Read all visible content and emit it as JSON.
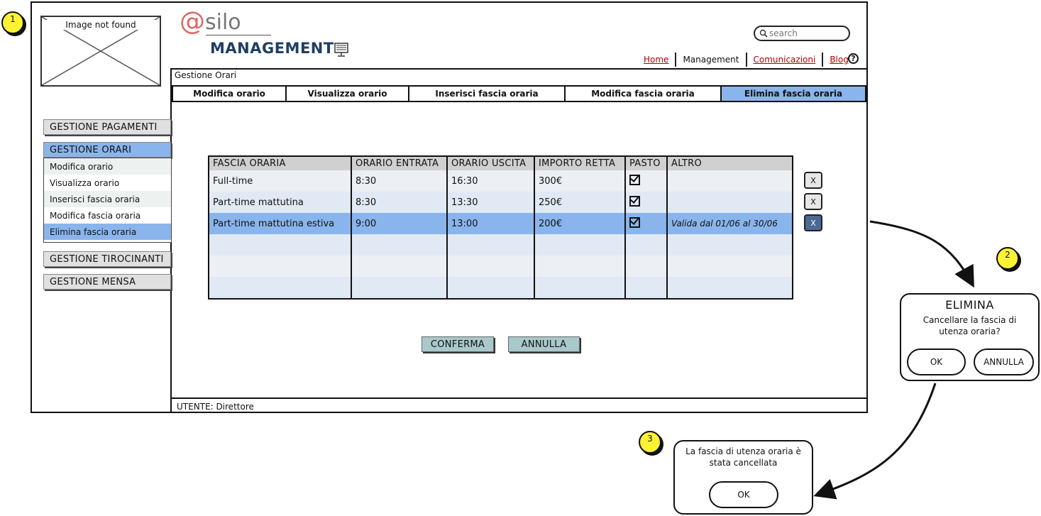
{
  "annotations": {
    "badge1": "1",
    "badge2": "2",
    "badge3": "3"
  },
  "logo": {
    "image_placeholder": "Image not found",
    "at": "@",
    "brand": "silo",
    "subtitle": "MANAGEMENT"
  },
  "search": {
    "placeholder": "search"
  },
  "topnav": {
    "home": "Home",
    "management": "Management",
    "comunicazioni": "Comunicazioni",
    "blog": "Blog",
    "help": "?"
  },
  "breadcrumb": "Gestione Orari",
  "tabs": [
    "Modifica orario",
    "Visualizza orario",
    "Inserisci fascia oraria",
    "Modifica fascia oraria",
    "Elimina fascia oraria"
  ],
  "sidebar": {
    "pagamenti": "GESTIONE PAGAMENTI",
    "orari": "GESTIONE ORARI",
    "submenu": [
      "Modifica orario",
      "Visualizza orario",
      "Inserisci fascia oraria",
      "Modifica fascia oraria",
      "Elimina fascia oraria"
    ],
    "tirocinanti": "GESTIONE TIROCINANTI",
    "mensa": "GESTIONE MENSA"
  },
  "table": {
    "headers": [
      "FASCIA ORARIA",
      "ORARIO ENTRATA",
      "ORARIO USCITA",
      "IMPORTO RETTA",
      "PASTO",
      "ALTRO"
    ],
    "rows": [
      {
        "fascia": "Full-time",
        "entrata": "8:30",
        "uscita": "16:30",
        "importo": "300€",
        "pasto": true,
        "altro": ""
      },
      {
        "fascia": "Part-time mattutina",
        "entrata": "8:30",
        "uscita": "13:30",
        "importo": "250€",
        "pasto": true,
        "altro": ""
      },
      {
        "fascia": "Part-time mattutina estiva",
        "entrata": "9:00",
        "uscita": "13:00",
        "importo": "200€",
        "pasto": true,
        "altro": "Valida dal 01/06 al 30/06"
      }
    ],
    "delete_label": "X"
  },
  "buttons": {
    "conferma": "CONFERMA",
    "annulla": "ANNULLA"
  },
  "footer": "UTENTE: Direttore",
  "dialog_elimina": {
    "title": "ELIMINA",
    "message": "Cancellare la fascia di utenza oraria?",
    "ok": "OK",
    "annulla": "ANNULLA"
  },
  "dialog_conferma": {
    "message": "La fascia di utenza oraria è stata cancellata",
    "ok": "OK"
  },
  "colors": {
    "accent": "#8ab4ec",
    "button": "#a9c8cc",
    "badge": "#fff233",
    "link": "#aa0000",
    "brand": "#1f3f63",
    "logo_at": "#e06666"
  }
}
